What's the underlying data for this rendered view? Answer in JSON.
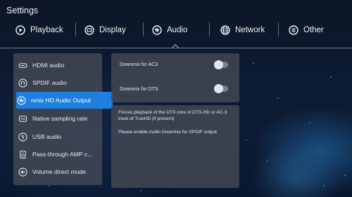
{
  "title": "Settings",
  "tabs": [
    {
      "label": "Playback",
      "icon": "play-circle-icon"
    },
    {
      "label": "Display",
      "icon": "display-icon"
    },
    {
      "label": "Audio",
      "icon": "audio-wave-icon"
    },
    {
      "label": "Network",
      "icon": "globe-icon"
    },
    {
      "label": "Other",
      "icon": "list-icon"
    }
  ],
  "selected_tab": "Audio",
  "sidebar": {
    "items": [
      {
        "label": "HDMI audio",
        "icon": "hdmi-icon"
      },
      {
        "label": "SPDIF audio",
        "icon": "spdif-icon"
      },
      {
        "label": "nmix HD Audio Output",
        "icon": "audio-wave-icon"
      },
      {
        "label": "Native sampling rate",
        "icon": "sampling-icon"
      },
      {
        "label": "USB audio",
        "icon": "usb-icon"
      },
      {
        "label": "Pass-through AMP c...",
        "icon": "amp-icon"
      },
      {
        "label": "Volume direct mode",
        "icon": "volume-icon"
      }
    ],
    "selected": "nmix HD Audio Output"
  },
  "options": [
    {
      "label": "Downmix for AC3",
      "enabled": false
    },
    {
      "label": "Downmix for DTS",
      "enabled": false
    }
  ],
  "description": {
    "line1": "Forces playback of the DTS core of DTS-HD or AC-3 track of TrueHD (if present)",
    "line2": "Please enable Audio Downmix for SPDIF output."
  },
  "colors": {
    "accent": "#1e7fe0",
    "panel": "#4a505a",
    "toggle_off": "#7b818b"
  }
}
